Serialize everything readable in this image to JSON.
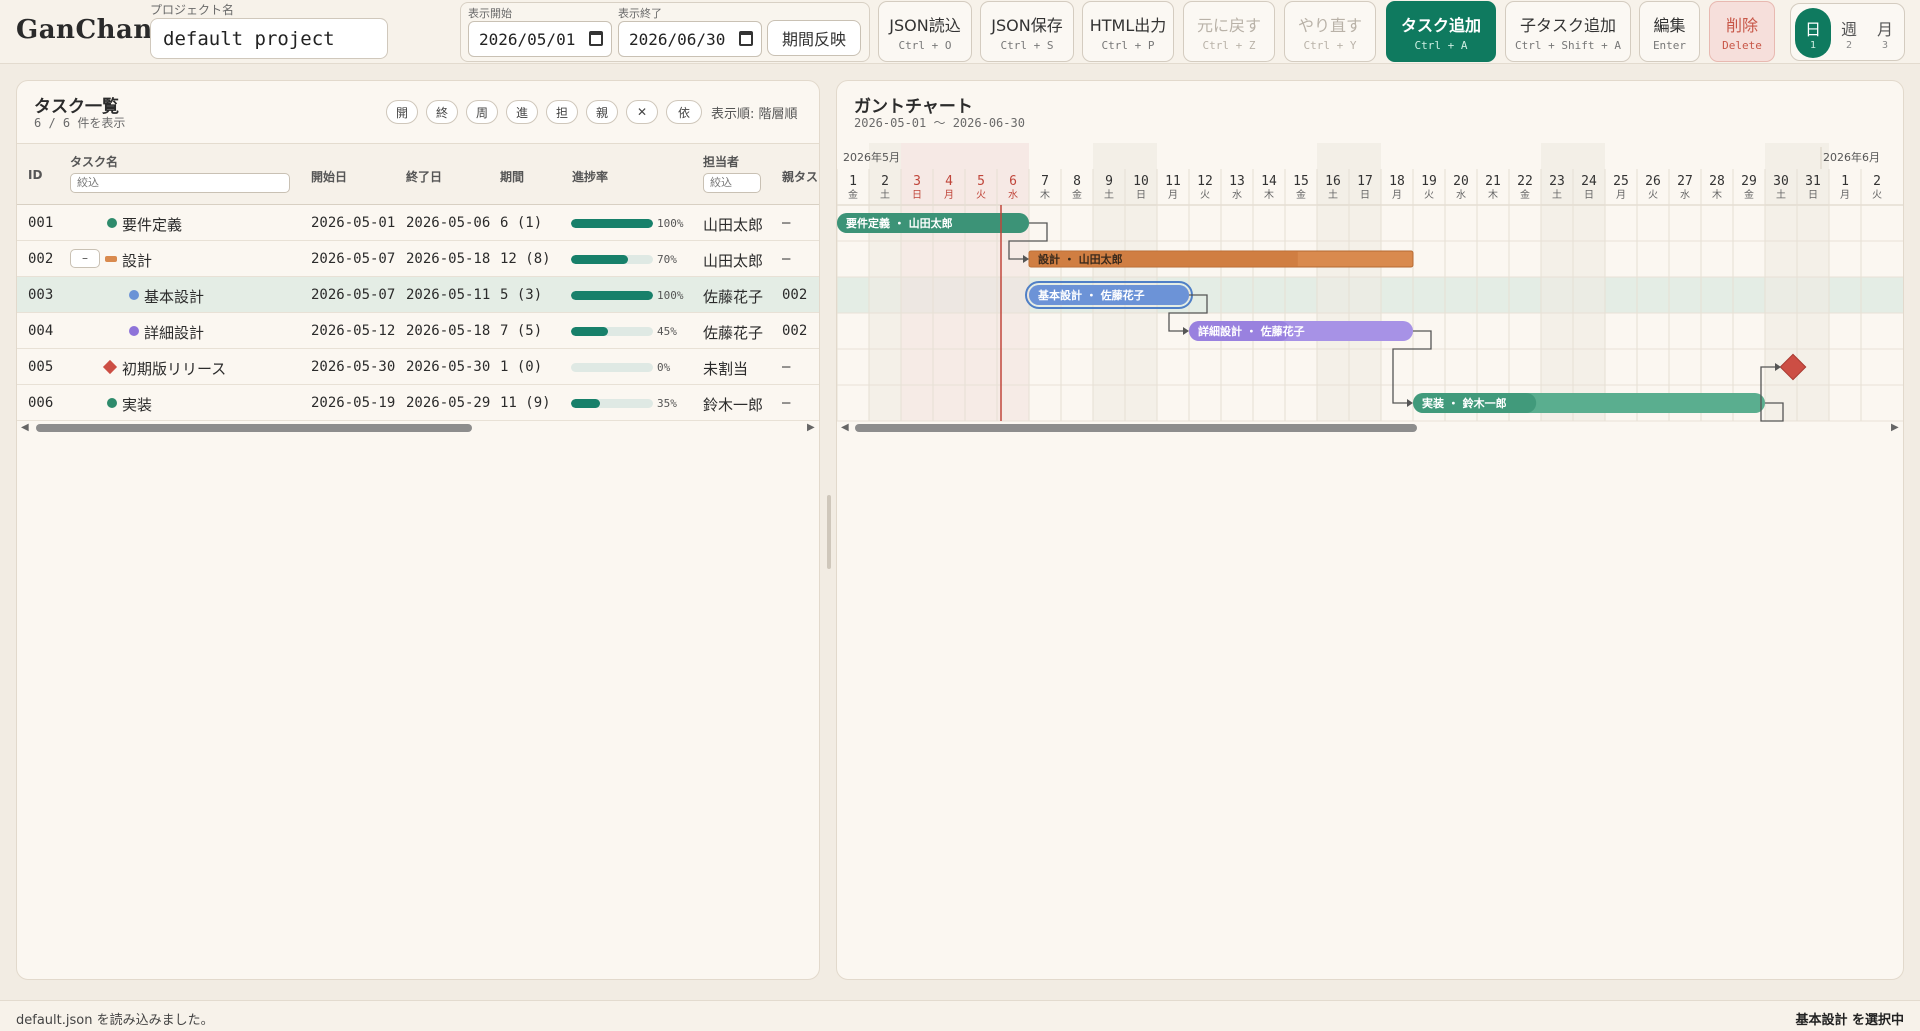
{
  "app": {
    "logo": "GanChan"
  },
  "project": {
    "label": "プロジェクト名",
    "value": "default project"
  },
  "period": {
    "start_label": "表示開始",
    "start_value": "2026/05/01",
    "end_label": "表示終了",
    "end_value": "2026/06/30",
    "apply_label": "期間反映"
  },
  "toolbar": {
    "json_load": {
      "label": "JSON読込",
      "shortcut": "Ctrl + O"
    },
    "json_save": {
      "label": "JSON保存",
      "shortcut": "Ctrl + S"
    },
    "html_export": {
      "label": "HTML出力",
      "shortcut": "Ctrl + P"
    },
    "undo": {
      "label": "元に戻す",
      "shortcut": "Ctrl + Z"
    },
    "redo": {
      "label": "やり直す",
      "shortcut": "Ctrl + Y"
    },
    "add_task": {
      "label": "タスク追加",
      "shortcut": "Ctrl + A"
    },
    "add_child": {
      "label": "子タスク追加",
      "shortcut": "Ctrl + Shift + A"
    },
    "edit": {
      "label": "編集",
      "shortcut": "Enter"
    },
    "delete": {
      "label": "削除",
      "shortcut": "Delete"
    }
  },
  "view_toggle": [
    {
      "label": "日",
      "key": "1",
      "active": true
    },
    {
      "label": "週",
      "key": "2",
      "active": false
    },
    {
      "label": "月",
      "key": "3",
      "active": false
    }
  ],
  "task_panel": {
    "title": "タスク一覧",
    "subtitle": "6 / 6 件を表示",
    "chips": [
      "開",
      "終",
      "周",
      "進",
      "担",
      "親",
      "✕",
      "依"
    ],
    "order_label": "表示順: 階層順",
    "columns": {
      "id": "ID",
      "name": "タスク名",
      "start": "開始日",
      "end": "終了日",
      "duration": "期間",
      "progress": "進捗率",
      "assignee": "担当者",
      "parent": "親タス"
    },
    "name_filter_placeholder": "絞込",
    "assignee_filter_placeholder": "絞込"
  },
  "tasks": [
    {
      "id": "001",
      "name": "要件定義",
      "start": "2026-05-01",
      "end": "2026-05-06",
      "duration": "6 (1)",
      "progress": 100,
      "progress_label": "100%",
      "assignee": "山田太郎",
      "parent": "–",
      "color": "#2e8b6c",
      "kind": "task",
      "depth": 0,
      "collapse": "",
      "selected": false
    },
    {
      "id": "002",
      "name": "設計",
      "start": "2026-05-07",
      "end": "2026-05-18",
      "duration": "12 (8)",
      "progress": 70,
      "progress_label": "70%",
      "assignee": "山田太郎",
      "parent": "–",
      "color": "#d98a4e",
      "kind": "group",
      "depth": 0,
      "collapse": "–",
      "selected": false
    },
    {
      "id": "003",
      "name": "基本設計",
      "start": "2026-05-07",
      "end": "2026-05-11",
      "duration": "5 (3)",
      "progress": 100,
      "progress_label": "100%",
      "assignee": "佐藤花子",
      "parent": "002",
      "color": "#6b93d6",
      "kind": "task",
      "depth": 1,
      "collapse": "",
      "selected": true
    },
    {
      "id": "004",
      "name": "詳細設計",
      "start": "2026-05-12",
      "end": "2026-05-18",
      "duration": "7 (5)",
      "progress": 45,
      "progress_label": "45%",
      "assignee": "佐藤花子",
      "parent": "002",
      "color": "#8e73d9",
      "kind": "task",
      "depth": 1,
      "collapse": "",
      "selected": false
    },
    {
      "id": "005",
      "name": "初期版リリース",
      "start": "2026-05-30",
      "end": "2026-05-30",
      "duration": "1 (0)",
      "progress": 0,
      "progress_label": "0%",
      "assignee": "未割当",
      "parent": "–",
      "color": "#cc4e44",
      "kind": "milestone",
      "depth": 0,
      "collapse": "",
      "selected": false
    },
    {
      "id": "006",
      "name": "実装",
      "start": "2026-05-19",
      "end": "2026-05-29",
      "duration": "11 (9)",
      "progress": 35,
      "progress_label": "35%",
      "assignee": "鈴木一郎",
      "parent": "–",
      "color": "#2e8b6c",
      "kind": "task",
      "depth": 0,
      "collapse": "",
      "selected": false
    }
  ],
  "gantt": {
    "title": "ガントチャート",
    "subtitle": "2026-05-01 〜 2026-06-30",
    "month_may": "2026年5月",
    "month_jun": "2026年6月",
    "today": 6,
    "days": [
      {
        "d": "1",
        "w": "金"
      },
      {
        "d": "2",
        "w": "土"
      },
      {
        "d": "3",
        "w": "日",
        "hol": true
      },
      {
        "d": "4",
        "w": "月",
        "hol": true
      },
      {
        "d": "5",
        "w": "火",
        "hol": true
      },
      {
        "d": "6",
        "w": "水",
        "hol": true
      },
      {
        "d": "7",
        "w": "木"
      },
      {
        "d": "8",
        "w": "金"
      },
      {
        "d": "9",
        "w": "土"
      },
      {
        "d": "10",
        "w": "日"
      },
      {
        "d": "11",
        "w": "月"
      },
      {
        "d": "12",
        "w": "火"
      },
      {
        "d": "13",
        "w": "水"
      },
      {
        "d": "14",
        "w": "木"
      },
      {
        "d": "15",
        "w": "金"
      },
      {
        "d": "16",
        "w": "土"
      },
      {
        "d": "17",
        "w": "日"
      },
      {
        "d": "18",
        "w": "月"
      },
      {
        "d": "19",
        "w": "火"
      },
      {
        "d": "20",
        "w": "水"
      },
      {
        "d": "21",
        "w": "木"
      },
      {
        "d": "22",
        "w": "金"
      },
      {
        "d": "23",
        "w": "土"
      },
      {
        "d": "24",
        "w": "日"
      },
      {
        "d": "25",
        "w": "月"
      },
      {
        "d": "26",
        "w": "火"
      },
      {
        "d": "27",
        "w": "水"
      },
      {
        "d": "28",
        "w": "木"
      },
      {
        "d": "29",
        "w": "金"
      },
      {
        "d": "30",
        "w": "土"
      },
      {
        "d": "31",
        "w": "日"
      },
      {
        "d": "1",
        "w": "月"
      },
      {
        "d": "2",
        "w": "火"
      }
    ],
    "bars": [
      {
        "label": "要件定義 ・ 山田太郎",
        "start": 1,
        "end": 6,
        "progress": 100,
        "color": "#4e9e86",
        "fill": "#2e8b6c"
      },
      {
        "label": "設計 ・ 山田太郎",
        "start": 7,
        "end": 18,
        "progress": 70,
        "color": "#d98a4e",
        "fill": "#c97539"
      },
      {
        "label": "基本設計 ・ 佐藤花子",
        "start": 7,
        "end": 11,
        "progress": 100,
        "color": "#7fa3e0",
        "fill": "#5d86cf",
        "selected": true
      },
      {
        "label": "詳細設計 ・ 佐藤花子",
        "start": 12,
        "end": 18,
        "progress": 45,
        "color": "#a792e6",
        "fill": "#8e73d9"
      },
      {
        "label": "",
        "start": 30,
        "end": 30,
        "progress": 0,
        "color": "#cc4e44",
        "fill": "#cc4e44",
        "milestone": true
      },
      {
        "label": "実装 ・ 鈴木一郎",
        "start": 19,
        "end": 29,
        "progress": 35,
        "color": "#5aae8f",
        "fill": "#2e8b6c"
      }
    ]
  },
  "status": {
    "message": "default.json を読み込みました。",
    "selection": "基本設計 を選択中"
  }
}
